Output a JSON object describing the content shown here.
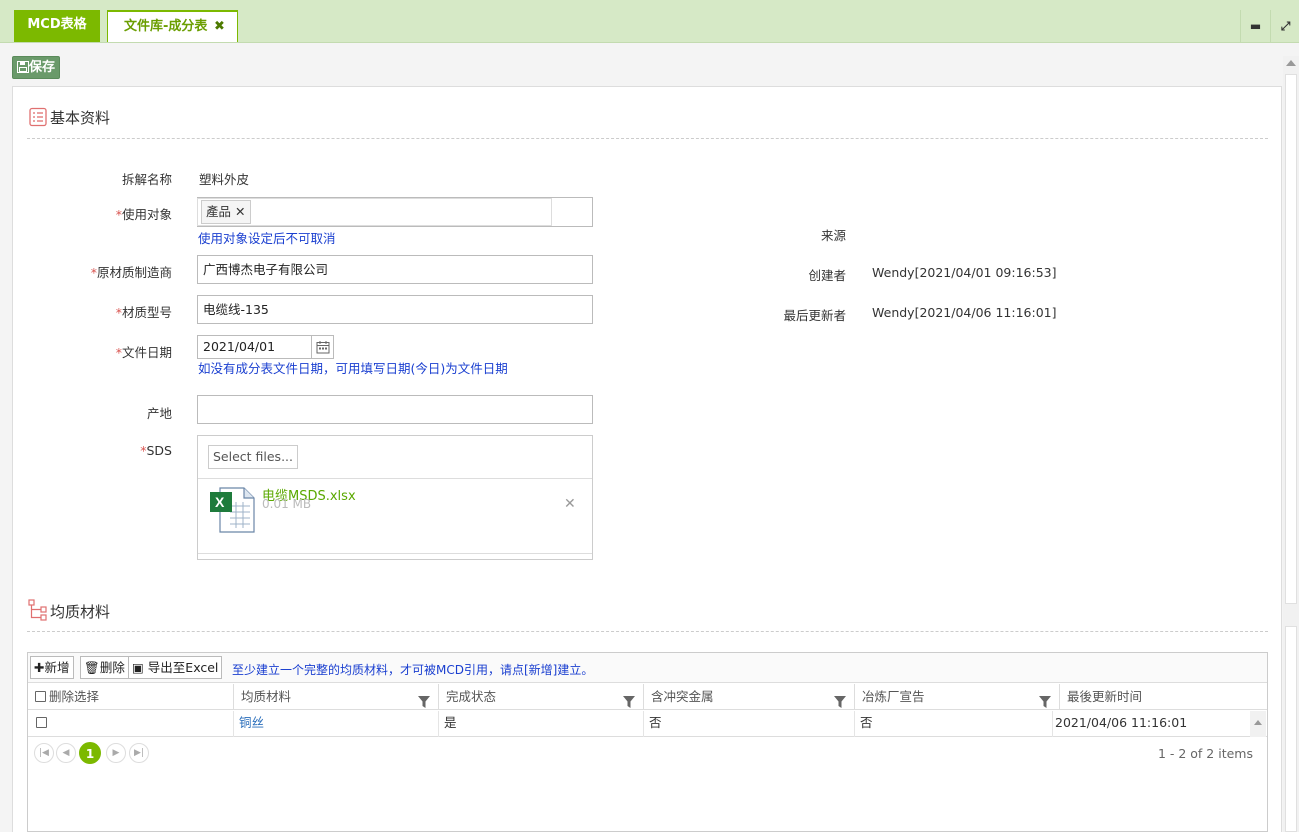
{
  "tabs": {
    "mcd": "MCD表格",
    "active": "文件库-成分表",
    "active_close": "✖"
  },
  "window": {
    "minimize": "▬",
    "maximize": "⤢"
  },
  "toolbar": {
    "save_label": "保存"
  },
  "basic": {
    "title": "基本资料",
    "fields": {
      "decompose_name_label": "拆解名称",
      "decompose_name_value": "塑料外皮",
      "use_target_label": "使用对象",
      "use_target_tag": "產品",
      "use_target_hint": "使用对象设定后不可取消",
      "manufacturer_label": "原材质制造商",
      "manufacturer_value": "广西博杰电子有限公司",
      "model_label": "材质型号",
      "model_value": "电缆线-135",
      "doc_date_label": "文件日期",
      "doc_date_value": "2021/04/01",
      "doc_date_hint": "如没有成分表文件日期，可用填写日期(今日)为文件日期",
      "origin_label": "产地",
      "origin_value": "",
      "sds_label": "SDS",
      "select_files": "Select files...",
      "file_name": "电缆MSDS.xlsx",
      "file_size": "0.01 MB",
      "file_remove": "✕"
    },
    "right": {
      "source_label": "来源",
      "source_value": "",
      "creator_label": "创建者",
      "creator_value": "Wendy[2021/04/01 09:16:53]",
      "updater_label": "最后更新者",
      "updater_value": "Wendy[2021/04/06 11:16:01]"
    }
  },
  "materials": {
    "title": "均质材料",
    "toolbar": {
      "add": "新增",
      "delete": "删除",
      "export": "导出至Excel",
      "hint": "至少建立一个完整的均质材料，才可被MCD引用，请点[新增]建立。"
    },
    "columns": [
      "删除选择",
      "均质材料",
      "完成状态",
      "含冲突金属",
      "冶炼厂宣告",
      "最後更新时间"
    ],
    "rows": [
      {
        "material": "铜丝",
        "status": "是",
        "conflict": "否",
        "smelter": "否",
        "updated": "2021/04/06 11:16:01"
      }
    ],
    "pager": {
      "current": "1",
      "info": "1 - 2 of 2 items"
    }
  },
  "colors": {
    "accent": "#7cb900",
    "tabbar": "#d6e9c6",
    "hint": "#1a3fd0",
    "required": "#d9534f"
  }
}
